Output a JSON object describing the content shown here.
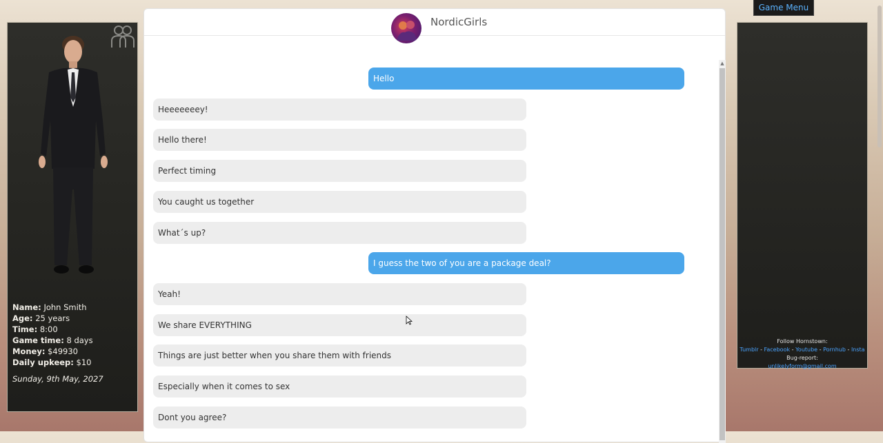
{
  "game_menu_label": "Game Menu",
  "player": {
    "name_label": "Name:",
    "name": "John Smith",
    "age_label": "Age:",
    "age": "25 years",
    "time_label": "Time:",
    "time": "8:00",
    "game_time_label": "Game time:",
    "game_time": "8 days",
    "money_label": "Money:",
    "money": "$49930",
    "upkeep_label": "Daily upkeep:",
    "upkeep": "$10",
    "date": "Sunday, 9th May, 2027"
  },
  "chat": {
    "contact_name": "NordicGirls",
    "messages": [
      {
        "from": "out",
        "text": "Hello"
      },
      {
        "from": "in",
        "text": "Heeeeeeey!"
      },
      {
        "from": "in",
        "text": "Hello there!"
      },
      {
        "from": "in",
        "text": "Perfect timing"
      },
      {
        "from": "in",
        "text": "You caught us together"
      },
      {
        "from": "in",
        "text": "What´s up?"
      },
      {
        "from": "out",
        "text": "I guess the two of you are a package deal?"
      },
      {
        "from": "in",
        "text": "Yeah!"
      },
      {
        "from": "in",
        "text": "We share EVERYTHING"
      },
      {
        "from": "in",
        "text": "Things are just better when you share them with friends"
      },
      {
        "from": "in",
        "text": "Especially when it comes to sex"
      },
      {
        "from": "in",
        "text": "Dont you agree?"
      }
    ]
  },
  "footer": {
    "follow": "Follow Hornstown:",
    "links": [
      "Tumblr",
      "Facebook",
      "Youtube",
      "Pornhub",
      "Insta"
    ],
    "bug_report": "Bug-report:",
    "email": "unlikelyform@gmail.com"
  },
  "colors": {
    "outgoing_bubble": "#4ba6ea",
    "incoming_bubble": "#ededed",
    "menu_text": "#5bb3ff"
  }
}
